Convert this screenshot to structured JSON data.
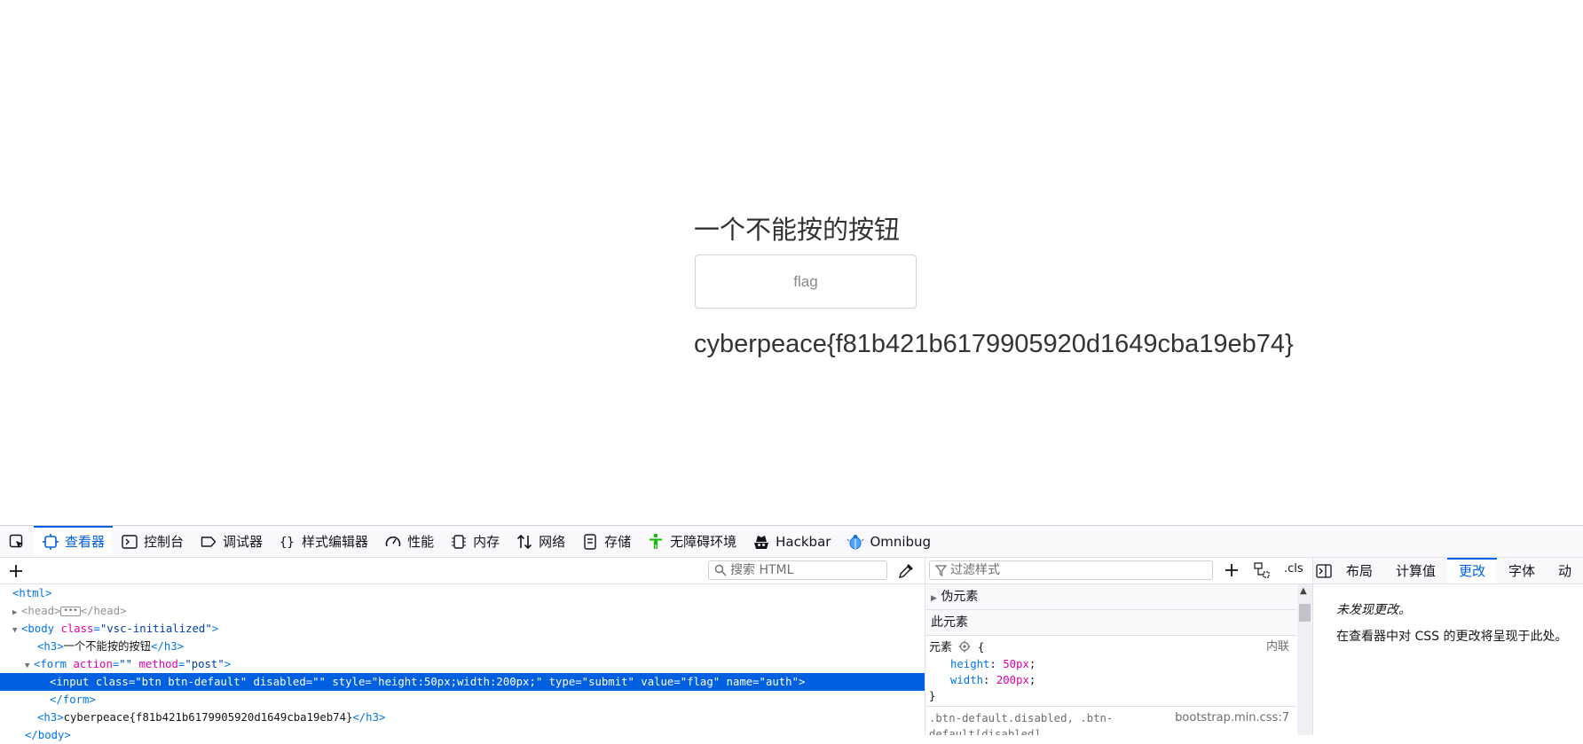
{
  "page": {
    "heading": "一个不能按的按钮",
    "button_value": "flag",
    "flag_text": "cyberpeace{f81b421b6179905920d1649cba19eb74}"
  },
  "devtools": {
    "tabs": [
      {
        "label": "查看器",
        "icon": "inspector-icon",
        "active": true
      },
      {
        "label": "控制台",
        "icon": "console-icon"
      },
      {
        "label": "调试器",
        "icon": "debugger-icon"
      },
      {
        "label": "样式编辑器",
        "icon": "style-editor-icon"
      },
      {
        "label": "性能",
        "icon": "performance-icon"
      },
      {
        "label": "内存",
        "icon": "memory-icon"
      },
      {
        "label": "网络",
        "icon": "network-icon"
      },
      {
        "label": "存储",
        "icon": "storage-icon"
      },
      {
        "label": "无障碍环境",
        "icon": "accessibility-icon"
      },
      {
        "label": "Hackbar",
        "icon": "hackbar-icon"
      },
      {
        "label": "Omnibug",
        "icon": "omnibug-icon"
      }
    ],
    "markup": {
      "search_placeholder": "搜索 HTML",
      "lines": {
        "html_open": "<html>",
        "head": [
          "<head>",
          "</head>"
        ],
        "body": {
          "tag_open": "<body",
          "attr": "class",
          "value": "\"vsc-initialized\"",
          "close": ">"
        },
        "h3_line": {
          "open": "<h3>",
          "text": "一个不能按的按钮",
          "close": "</h3>"
        },
        "form": {
          "tag_open": "<form",
          "attr1": "action",
          "val1": "\"\"",
          "attr2": "method",
          "val2": "\"post\"",
          "close": ">"
        },
        "input_line": "<input class=\"btn btn-default\" disabled=\"\" style=\"height:50px;width:200px;\" type=\"submit\" value=\"flag\" name=\"auth\">",
        "form_close": "</form>",
        "h3_flag": {
          "open": "<h3>",
          "text": "cyberpeace{f81b421b6179905920d1649cba19eb74}",
          "close": "</h3>"
        },
        "body_close": "</body>"
      }
    },
    "rules": {
      "filter_placeholder": "过滤样式",
      "cls_label": ".cls",
      "pseudo_label": "伪元素",
      "this_element_label": "此元素",
      "element_rule": {
        "selector": "元素",
        "brace_open": "{",
        "source": "内联",
        "props": [
          {
            "name": "height",
            "value": "50px"
          },
          {
            "name": "width",
            "value": "200px"
          }
        ],
        "brace_close": "}"
      },
      "next_rule": {
        "selector_line1": ".btn-default.disabled, .btn-",
        "selector_line2": "default[disabled],",
        "source": "bootstrap.min.css:7"
      }
    },
    "side": {
      "tabs": [
        "布局",
        "计算值",
        "更改",
        "字体",
        "动"
      ],
      "active_tab": "更改",
      "empty_text": "未发现更改。",
      "hint_text": "在查看器中对 CSS 的更改将呈现于此处。"
    }
  }
}
